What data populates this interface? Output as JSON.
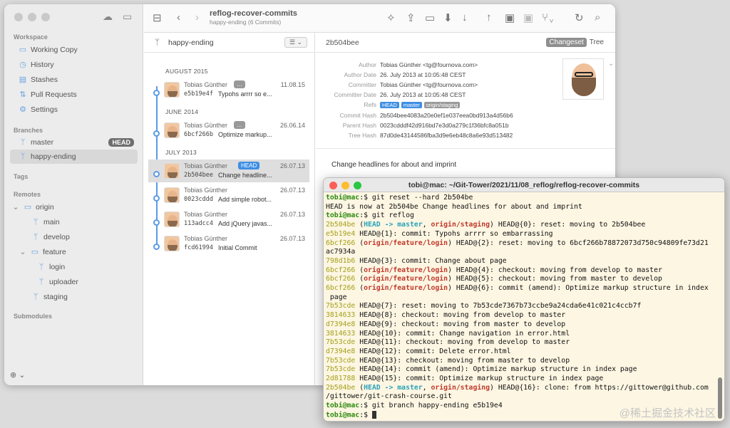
{
  "sidebar": {
    "sections": {
      "workspace": "Workspace",
      "branches": "Branches",
      "tags": "Tags",
      "remotes": "Remotes",
      "submodules": "Submodules"
    },
    "workspace": [
      {
        "label": "Working Copy",
        "icon": "folder-icon"
      },
      {
        "label": "History",
        "icon": "clock-icon"
      },
      {
        "label": "Stashes",
        "icon": "stash-icon"
      },
      {
        "label": "Pull Requests",
        "icon": "pull-request-icon"
      },
      {
        "label": "Settings",
        "icon": "gear-icon"
      }
    ],
    "branches": [
      {
        "label": "master",
        "badge": "HEAD"
      },
      {
        "label": "happy-ending"
      }
    ],
    "remotes": {
      "origin": "origin",
      "items": [
        "main",
        "develop",
        "feature",
        "login",
        "uploader",
        "staging"
      ]
    },
    "footer": "⊕ ⌄"
  },
  "toolbar": {
    "repo_title": "reflog-recover-commits",
    "repo_subtitle": "happy-ending (6 Commits)"
  },
  "history": {
    "branch": "happy-ending",
    "months": [
      "AUGUST 2015",
      "JUNE 2014",
      "JULY 2013"
    ],
    "commits": [
      {
        "author": "Tobias Günther",
        "date": "11.08.15",
        "hash": "e5b19e4f",
        "msg": "Typohs arrrr so e..."
      },
      {
        "author": "Tobias Günther",
        "date": "26.06.14",
        "hash": "6bcf266b",
        "msg": "Optimize markup..."
      },
      {
        "author": "Tobias Günther",
        "date": "26.07.13",
        "hash": "2b504bee",
        "msg": "Change headline...",
        "tag": "HEAD"
      },
      {
        "author": "Tobias Günther",
        "date": "26.07.13",
        "hash": "0023cddd",
        "msg": "Add simple robot..."
      },
      {
        "author": "Tobias Günther",
        "date": "26.07.13",
        "hash": "113adcc4",
        "msg": "Add jQuery javas..."
      },
      {
        "author": "Tobias Günther",
        "date": "26.07.13",
        "hash": "fcd61994",
        "msg": "Initial Commit"
      }
    ]
  },
  "detail": {
    "hash": "2b504bee",
    "tabs": {
      "changeset": "Changeset",
      "tree": "Tree"
    },
    "rows": [
      {
        "k": "Author",
        "v": "Tobias Günther <tg@fournova.com>"
      },
      {
        "k": "Author Date",
        "v": "26. July 2013 at 10:05:48 CEST"
      },
      {
        "k": "Committer",
        "v": "Tobias Günther <tg@fournova.com>"
      },
      {
        "k": "Committer Date",
        "v": "26. July 2013 at 10:05:48 CEST"
      },
      {
        "k": "Refs",
        "v": ""
      },
      {
        "k": "Commit Hash",
        "v": "2b504bee4083a20e0ef1e037eea0bd913a4d56b6"
      },
      {
        "k": "Parent Hash",
        "v": "0023cdddf42d916bd7e3d0a279c1f36bfc8a051b"
      },
      {
        "k": "Tree Hash",
        "v": "87d0de43144586fba3d9e6eb48c8a6e93d513482"
      }
    ],
    "refs": [
      {
        "label": "HEAD",
        "color": "#3f8fe4"
      },
      {
        "label": "master",
        "color": "#3f8fe4"
      },
      {
        "label": "origin/staging",
        "color": "#9a9a9a"
      }
    ],
    "subject": "Change headlines for about and imprint"
  },
  "terminal": {
    "title": "tobi@mac: ~/Git-Tower/2021/11/08_reflog/reflog-recover-commits",
    "colors": {
      "prompt": "#2b8a0f",
      "hash": "#a3a01a",
      "head": "#2aa3b8",
      "red": "#c0392b"
    }
  },
  "watermark": "@稀土掘金技术社区"
}
